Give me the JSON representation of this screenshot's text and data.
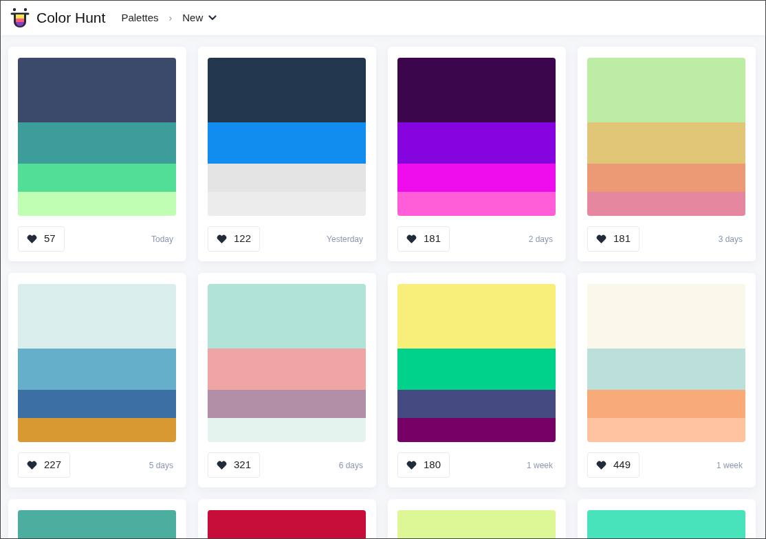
{
  "header": {
    "brand": "Color Hunt",
    "breadcrumb": [
      {
        "label": "Palettes",
        "separator": "›"
      },
      {
        "label": "New"
      }
    ]
  },
  "palettes": [
    {
      "stripes": [
        {
          "color": "#3b4a6b"
        },
        {
          "color": "#3c9d9b"
        },
        {
          "color": "#52de97"
        },
        {
          "color": "#c0ffb3"
        }
      ],
      "likes": "57",
      "date": "Today"
    },
    {
      "stripes": [
        {
          "color": "#22364e"
        },
        {
          "color": "#118df0"
        },
        {
          "color": "#e4e4e4"
        },
        {
          "color": "#ececec"
        }
      ],
      "likes": "122",
      "date": "Yesterday"
    },
    {
      "stripes": [
        {
          "color": "#3c064d"
        },
        {
          "color": "#8605de"
        },
        {
          "color": "#ee0ced"
        },
        {
          "color": "#ff5ed8"
        }
      ],
      "likes": "181",
      "date": "2 days"
    },
    {
      "stripes": [
        {
          "color": "#bdeca4"
        },
        {
          "color": "#e2c677"
        },
        {
          "color": "#ec9a75"
        },
        {
          "color": "#e5889f"
        }
      ],
      "likes": "181",
      "date": "3 days"
    },
    {
      "stripes": [
        {
          "color": "#d9edec"
        },
        {
          "color": "#65afcb"
        },
        {
          "color": "#3c6fa4"
        },
        {
          "color": "#d99932"
        }
      ],
      "likes": "227",
      "date": "5 days"
    },
    {
      "stripes": [
        {
          "color": "#b1e4d6"
        },
        {
          "color": "#f0a5a5"
        },
        {
          "color": "#b28ea7"
        },
        {
          "color": "#e5f3ee"
        }
      ],
      "likes": "321",
      "date": "6 days"
    },
    {
      "stripes": [
        {
          "color": "#f7ef7a"
        },
        {
          "color": "#00d18b"
        },
        {
          "color": "#444a80"
        },
        {
          "color": "#770066"
        }
      ],
      "likes": "180",
      "date": "1 week"
    },
    {
      "stripes": [
        {
          "color": "#faf8ea"
        },
        {
          "color": "#bbe0dc"
        },
        {
          "color": "#f8ab78"
        },
        {
          "color": "#ffc49f"
        }
      ],
      "likes": "449",
      "date": "1 week"
    },
    {
      "stripes": [
        {
          "color": "#4cae9f"
        }
      ]
    },
    {
      "stripes": [
        {
          "color": "#c70e3a"
        }
      ]
    },
    {
      "stripes": [
        {
          "color": "#ddf797"
        }
      ]
    },
    {
      "stripes": [
        {
          "color": "#48e3bb"
        }
      ]
    }
  ]
}
